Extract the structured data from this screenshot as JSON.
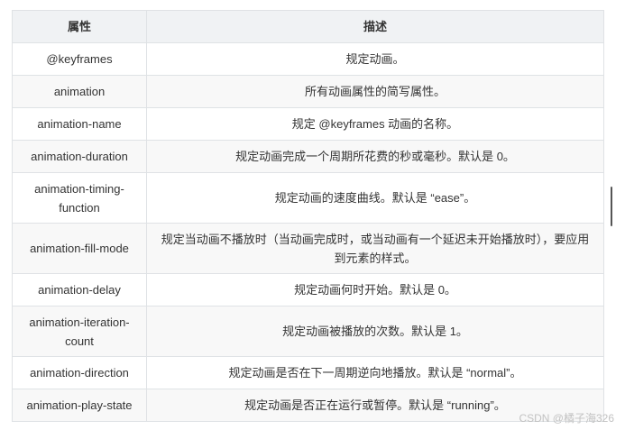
{
  "table": {
    "headers": {
      "property": "属性",
      "description": "描述"
    },
    "rows": [
      {
        "property": "@keyframes",
        "description": "规定动画。"
      },
      {
        "property": "animation",
        "description": "所有动画属性的简写属性。"
      },
      {
        "property": "animation-name",
        "description": "规定 @keyframes 动画的名称。"
      },
      {
        "property": "animation-duration",
        "description": "规定动画完成一个周期所花费的秒或毫秒。默认是 0。"
      },
      {
        "property": "animation-timing-function",
        "description": "规定动画的速度曲线。默认是 “ease”。"
      },
      {
        "property": "animation-fill-mode",
        "description": "规定当动画不播放时（当动画完成时，或当动画有一个延迟未开始播放时），要应用到元素的样式。"
      },
      {
        "property": "animation-delay",
        "description": "规定动画何时开始。默认是 0。"
      },
      {
        "property": "animation-iteration-count",
        "description": "规定动画被播放的次数。默认是 1。"
      },
      {
        "property": "animation-direction",
        "description": "规定动画是否在下一周期逆向地播放。默认是 “normal”。"
      },
      {
        "property": "animation-play-state",
        "description": "规定动画是否正在运行或暂停。默认是 “running”。"
      }
    ]
  },
  "watermark": "CSDN @橘子海326",
  "colors": {
    "header_bg": "#f0f2f4",
    "row_alt_bg": "#f8f8f8",
    "border": "#dfe2e5",
    "text": "#333333"
  }
}
